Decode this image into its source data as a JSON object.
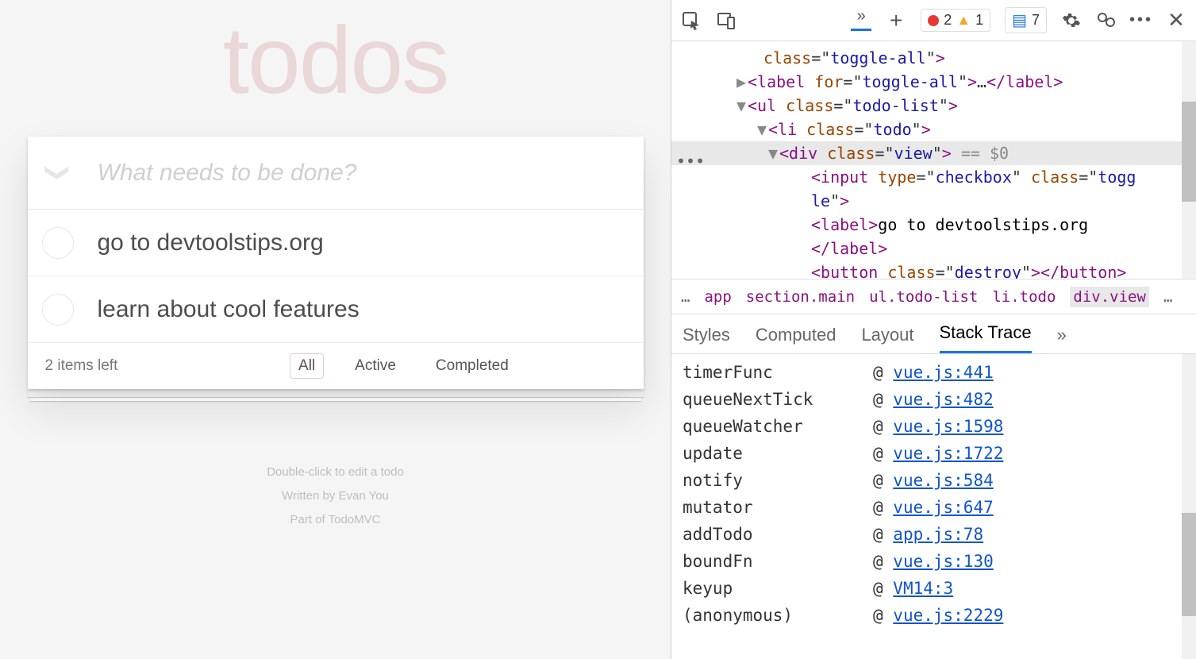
{
  "app": {
    "title": "todos",
    "placeholder": "What needs to be done?",
    "items": [
      {
        "label": "go to devtoolstips.org",
        "completed": false
      },
      {
        "label": "learn about cool features",
        "completed": false
      }
    ],
    "count_text": "2 items left",
    "filters": {
      "all": "All",
      "active": "Active",
      "completed": "Completed",
      "selected": "all"
    },
    "info": {
      "line1": "Double-click to edit a todo",
      "line2": "Written by Evan You",
      "line3": "Part of TodoMVC"
    }
  },
  "devtools": {
    "toolbar": {
      "errors": "2",
      "warnings": "1",
      "issues": "7"
    },
    "dom_lines": [
      {
        "indent": 100,
        "html": "<span class='attrname'>class</span>=\"<span class='attrval'>toggle-all</span>\"<span class='tag'>&gt;</span>"
      },
      {
        "indent": 80,
        "caret": "▶",
        "html": "<span class='tag'>&lt;label</span> <span class='attrname'>for</span>=\"<span class='attrval'>toggle-all</span>\"<span class='tag'>&gt;</span>…<span class='tag'>&lt;/label&gt;</span>"
      },
      {
        "indent": 80,
        "caret": "▼",
        "html": "<span class='tag'>&lt;ul</span> <span class='attrname'>class</span>=\"<span class='attrval'>todo-list</span>\"<span class='tag'>&gt;</span>"
      },
      {
        "indent": 106,
        "caret": "▼",
        "html": "<span class='tag'>&lt;li</span> <span class='attrname'>class</span>=\"<span class='attrval'>todo</span>\"<span class='tag'>&gt;</span>"
      },
      {
        "indent": 120,
        "caret": "▼",
        "selected": true,
        "html": "<span class='tag'>&lt;div</span> <span class='attrname'>class</span>=\"<span class='attrval'>view</span>\"<span class='tag'>&gt;</span> <span class='dom-selected-extra'>== $0</span>"
      },
      {
        "indent": 160,
        "html": "<span class='tag'>&lt;input</span> <span class='attrname'>type</span>=\"<span class='attrval'>checkbox</span>\" <span class='attrname'>class</span>=\"<span class='attrval'>togg</span>"
      },
      {
        "indent": 160,
        "html": "<span class='attrval'>le</span>\"<span class='tag'>&gt;</span>"
      },
      {
        "indent": 160,
        "html": "<span class='tag'>&lt;label&gt;</span><span class='txt'>go to devtoolstips.org</span>"
      },
      {
        "indent": 160,
        "html": "<span class='tag'>&lt;/label&gt;</span>"
      },
      {
        "indent": 160,
        "html": "<span class='tag'>&lt;button</span> <span class='attrname'>class</span>=\"<span class='attrval'>destroy</span>\"<span class='tag'>&gt;&lt;/button&gt;</span>"
      }
    ],
    "breadcrumb": [
      "…",
      "app",
      "section.main",
      "ul.todo-list",
      "li.todo",
      "div.view",
      "…"
    ],
    "breadcrumb_selected": "div.view",
    "subtabs": [
      "Styles",
      "Computed",
      "Layout",
      "Stack Trace"
    ],
    "subtab_selected": "Stack Trace",
    "subtab_overflow": "»",
    "stack": [
      {
        "fn": "timerFunc",
        "loc": "vue.js:441"
      },
      {
        "fn": "queueNextTick",
        "loc": "vue.js:482"
      },
      {
        "fn": "queueWatcher",
        "loc": "vue.js:1598"
      },
      {
        "fn": "update",
        "loc": "vue.js:1722"
      },
      {
        "fn": "notify",
        "loc": "vue.js:584"
      },
      {
        "fn": "mutator",
        "loc": "vue.js:647"
      },
      {
        "fn": "addTodo",
        "loc": "app.js:78"
      },
      {
        "fn": "boundFn",
        "loc": "vue.js:130"
      },
      {
        "fn": "keyup",
        "loc": "VM14:3"
      },
      {
        "fn": "(anonymous)",
        "loc": "vue.js:2229"
      }
    ],
    "at": "@"
  }
}
